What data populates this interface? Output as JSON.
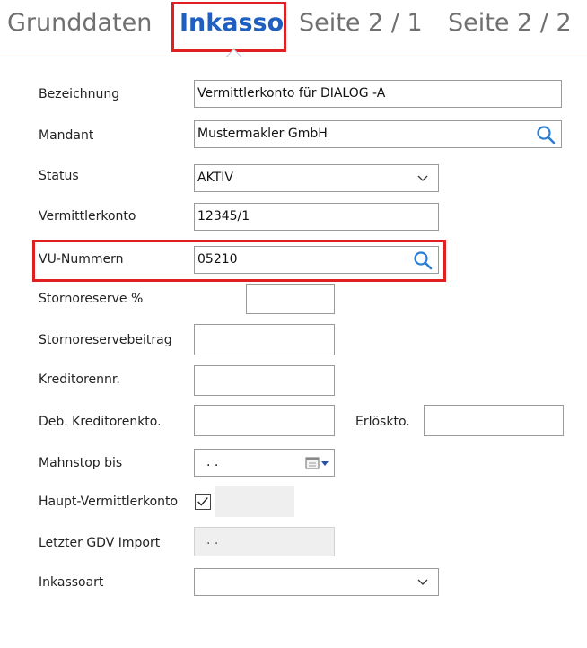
{
  "tabs": [
    {
      "label": "Grunddaten",
      "active": false
    },
    {
      "label": "Inkasso",
      "active": true
    },
    {
      "label": "Seite 2 / 1",
      "active": false
    },
    {
      "label": "Seite 2 / 2",
      "active": false
    }
  ],
  "form": {
    "bezeichnung": {
      "label": "Bezeichnung",
      "value": "Vermittlerkonto für DIALOG -A"
    },
    "mandant": {
      "label": "Mandant",
      "value": "Mustermakler GmbH",
      "icon": "search-icon"
    },
    "status": {
      "label": "Status",
      "value": "AKTIV",
      "icon": "chevron-down-icon"
    },
    "vermittlerkonto": {
      "label": "Vermittlerkonto",
      "value": "12345/1"
    },
    "vu_nummern": {
      "label": "VU-Nummern",
      "value": "05210",
      "icon": "search-icon"
    },
    "stornoreserve_pct": {
      "label": "Stornoreserve %",
      "value": ""
    },
    "stornoreservebeitrag": {
      "label": "Stornoreservebeitrag",
      "value": ""
    },
    "kreditorennr": {
      "label": "Kreditorennr.",
      "value": ""
    },
    "deb_kreditorenkto": {
      "label": "Deb. Kreditorenkto.",
      "value": ""
    },
    "erloeskto": {
      "label": "Erlöskto.",
      "value": ""
    },
    "mahnstop_bis": {
      "label": "Mahnstop bis",
      "value": ". .",
      "icon": "calendar-icon"
    },
    "haupt_vermittlerkonto": {
      "label": "Haupt-Vermittlerkonto",
      "checked": true
    },
    "letzter_gdv_import": {
      "label": "Letzter GDV Import",
      "value": ". ."
    },
    "inkassoart": {
      "label": "Inkassoart",
      "value": "",
      "icon": "chevron-down-icon"
    }
  },
  "colors": {
    "accent": "#1f5fbf",
    "highlight": "#e02020",
    "search_icon": "#2a7fd4"
  }
}
